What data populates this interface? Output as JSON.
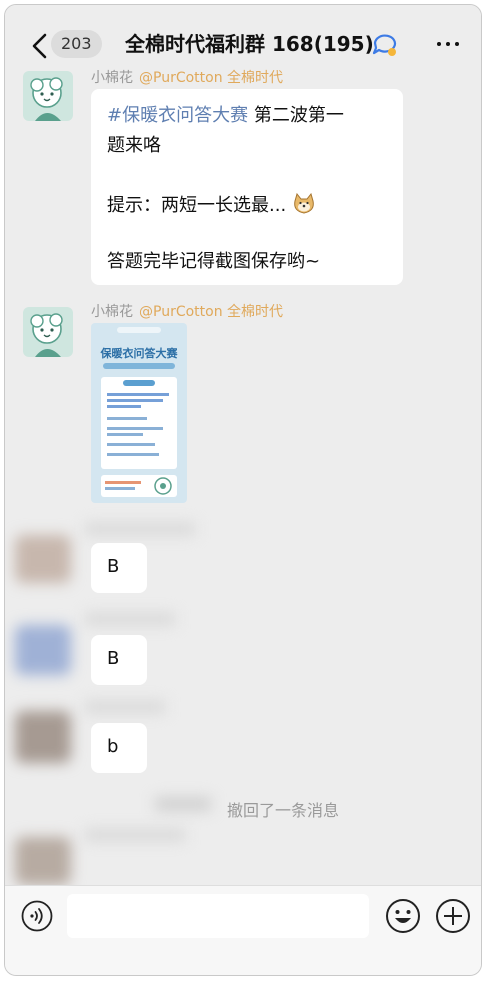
{
  "header": {
    "unread_count": "203",
    "title": "全棉时代福利群 168(195)"
  },
  "messages": [
    {
      "sender": "小棉花",
      "handle": "@PurCotton 全棉时代",
      "text_tag": "#保暖衣问答大赛",
      "text_line1_rest": " 第二波第一",
      "text_line2": "题来咯",
      "text_line3": "提示：两短一长选最...",
      "text_line4": "答题完毕记得截图保存哟~"
    },
    {
      "sender": "小棉花",
      "handle": "@PurCotton 全棉时代",
      "poster": {
        "title": "保暖衣问答大赛"
      }
    },
    {
      "text": "B"
    },
    {
      "text": "B"
    },
    {
      "text": "b"
    }
  ],
  "recall_notice": "撤回了一条消息",
  "colors": {
    "background": "#ededed",
    "bubble": "#ffffff",
    "tag": "#5f7fb1",
    "handle": "#e0a95b"
  }
}
